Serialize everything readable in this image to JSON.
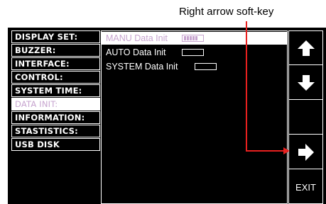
{
  "annotation": {
    "text": "Right arrow soft-key"
  },
  "menu": {
    "items": [
      {
        "label": "DISPLAY SET:"
      },
      {
        "label": "BUZZER:"
      },
      {
        "label": "INTERFACE:"
      },
      {
        "label": "CONTROL:"
      },
      {
        "label": "SYSTEM TIME:"
      },
      {
        "label": "DATA INIT:",
        "selected": true
      },
      {
        "label": "INFORMATION:"
      },
      {
        "label": "STASTISTICS:"
      },
      {
        "label": "USB DISK"
      }
    ]
  },
  "options": [
    {
      "label": "MANU Data Init",
      "progress": 0.7,
      "selected": true
    },
    {
      "label": "AUTO Data Init",
      "progress": 0
    },
    {
      "label": "SYSTEM Data Init",
      "progress": 0
    }
  ],
  "softkeys": [
    {
      "icon": "up-arrow-icon"
    },
    {
      "icon": "down-arrow-icon"
    },
    {
      "icon": ""
    },
    {
      "icon": "right-arrow-icon"
    },
    {
      "label": "EXIT"
    }
  ],
  "colors": {
    "background": "#000000",
    "foreground": "#ffffff",
    "highlight_text": "#c7a4cf",
    "callout": "#e8201f"
  }
}
